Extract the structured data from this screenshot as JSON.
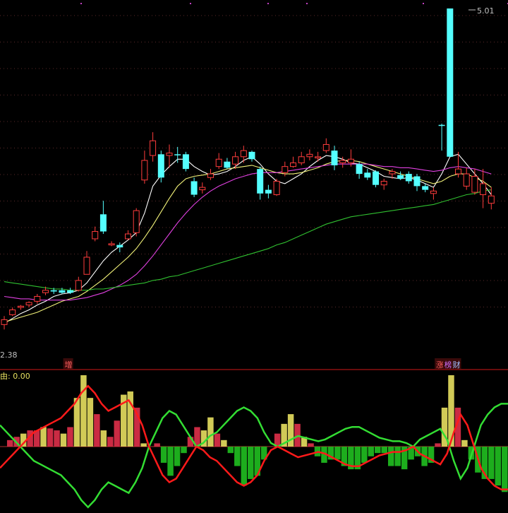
{
  "chart_data": [
    {
      "type": "candlestick",
      "panel": "price",
      "price_range": [
        2.38,
        5.01
      ],
      "high_label": "5.01",
      "low_label": "2.38",
      "markers": [
        {
          "text": "增",
          "candle": 8
        },
        {
          "text": "涨",
          "candle": 53
        },
        {
          "text": "榜",
          "candle": 54
        },
        {
          "text": "财",
          "candle": 55
        }
      ],
      "candles": [
        {
          "o": 2.43,
          "h": 2.5,
          "l": 2.39,
          "c": 2.47,
          "up": true
        },
        {
          "o": 2.51,
          "h": 2.57,
          "l": 2.5,
          "c": 2.55,
          "up": true
        },
        {
          "o": 2.57,
          "h": 2.59,
          "l": 2.55,
          "c": 2.58,
          "up": true
        },
        {
          "o": 2.59,
          "h": 2.62,
          "l": 2.57,
          "c": 2.61,
          "up": true
        },
        {
          "o": 2.62,
          "h": 2.68,
          "l": 2.6,
          "c": 2.66,
          "up": true
        },
        {
          "o": 2.69,
          "h": 2.74,
          "l": 2.67,
          "c": 2.71,
          "up": true
        },
        {
          "o": 2.7,
          "h": 2.73,
          "l": 2.68,
          "c": 2.71,
          "up": false
        },
        {
          "o": 2.71,
          "h": 2.73,
          "l": 2.68,
          "c": 2.69,
          "up": false
        },
        {
          "o": 2.69,
          "h": 2.73,
          "l": 2.68,
          "c": 2.71,
          "up": false
        },
        {
          "o": 2.71,
          "h": 2.82,
          "l": 2.7,
          "c": 2.79,
          "up": true
        },
        {
          "o": 2.84,
          "h": 3.03,
          "l": 2.84,
          "c": 2.98,
          "up": true
        },
        {
          "o": 3.13,
          "h": 3.23,
          "l": 3.11,
          "c": 3.19,
          "up": true
        },
        {
          "o": 3.33,
          "h": 3.44,
          "l": 3.17,
          "c": 3.19,
          "up": false
        },
        {
          "o": 3.08,
          "h": 3.11,
          "l": 3.07,
          "c": 3.09,
          "up": true
        },
        {
          "o": 3.08,
          "h": 3.1,
          "l": 3.02,
          "c": 3.06,
          "up": false
        },
        {
          "o": 3.13,
          "h": 3.2,
          "l": 3.12,
          "c": 3.17,
          "up": true
        },
        {
          "o": 3.18,
          "h": 3.38,
          "l": 3.15,
          "c": 3.36,
          "up": true
        },
        {
          "o": 3.61,
          "h": 3.85,
          "l": 3.58,
          "c": 3.77,
          "up": true
        },
        {
          "o": 3.81,
          "h": 4.0,
          "l": 3.76,
          "c": 3.93,
          "up": true
        },
        {
          "o": 3.82,
          "h": 3.85,
          "l": 3.59,
          "c": 3.63,
          "up": false
        },
        {
          "o": 3.81,
          "h": 3.9,
          "l": 3.71,
          "c": 3.83,
          "up": true
        },
        {
          "o": 3.82,
          "h": 3.88,
          "l": 3.75,
          "c": 3.82,
          "up": false
        },
        {
          "o": 3.82,
          "h": 3.84,
          "l": 3.68,
          "c": 3.7,
          "up": false
        },
        {
          "o": 3.6,
          "h": 3.63,
          "l": 3.47,
          "c": 3.49,
          "up": false
        },
        {
          "o": 3.53,
          "h": 3.59,
          "l": 3.5,
          "c": 3.55,
          "up": true
        },
        {
          "o": 3.63,
          "h": 3.7,
          "l": 3.61,
          "c": 3.66,
          "up": true
        },
        {
          "o": 3.72,
          "h": 3.83,
          "l": 3.7,
          "c": 3.78,
          "up": true
        },
        {
          "o": 3.76,
          "h": 3.79,
          "l": 3.7,
          "c": 3.71,
          "up": false
        },
        {
          "o": 3.74,
          "h": 3.84,
          "l": 3.7,
          "c": 3.8,
          "up": true
        },
        {
          "o": 3.8,
          "h": 3.89,
          "l": 3.75,
          "c": 3.85,
          "up": true
        },
        {
          "o": 3.84,
          "h": 3.85,
          "l": 3.76,
          "c": 3.78,
          "up": false
        },
        {
          "o": 3.7,
          "h": 3.72,
          "l": 3.45,
          "c": 3.5,
          "up": false
        },
        {
          "o": 3.53,
          "h": 3.57,
          "l": 3.46,
          "c": 3.5,
          "up": false
        },
        {
          "o": 3.49,
          "h": 3.62,
          "l": 3.48,
          "c": 3.6,
          "up": true
        },
        {
          "o": 3.67,
          "h": 3.76,
          "l": 3.64,
          "c": 3.72,
          "up": true
        },
        {
          "o": 3.72,
          "h": 3.8,
          "l": 3.71,
          "c": 3.75,
          "up": true
        },
        {
          "o": 3.75,
          "h": 3.84,
          "l": 3.73,
          "c": 3.8,
          "up": true
        },
        {
          "o": 3.8,
          "h": 3.86,
          "l": 3.77,
          "c": 3.82,
          "up": true
        },
        {
          "o": 3.79,
          "h": 3.84,
          "l": 3.76,
          "c": 3.8,
          "up": true
        },
        {
          "o": 3.85,
          "h": 3.95,
          "l": 3.83,
          "c": 3.9,
          "up": true
        },
        {
          "o": 3.85,
          "h": 3.89,
          "l": 3.69,
          "c": 3.73,
          "up": false
        },
        {
          "o": 3.75,
          "h": 3.8,
          "l": 3.71,
          "c": 3.77,
          "up": true
        },
        {
          "o": 3.78,
          "h": 3.86,
          "l": 3.72,
          "c": 3.75,
          "up": true
        },
        {
          "o": 3.74,
          "h": 3.76,
          "l": 3.62,
          "c": 3.66,
          "up": false
        },
        {
          "o": 3.67,
          "h": 3.7,
          "l": 3.61,
          "c": 3.63,
          "up": false
        },
        {
          "o": 3.68,
          "h": 3.69,
          "l": 3.55,
          "c": 3.57,
          "up": false
        },
        {
          "o": 3.57,
          "h": 3.62,
          "l": 3.53,
          "c": 3.6,
          "up": true
        },
        {
          "o": 3.66,
          "h": 3.7,
          "l": 3.62,
          "c": 3.68,
          "up": true
        },
        {
          "o": 3.65,
          "h": 3.68,
          "l": 3.61,
          "c": 3.62,
          "up": false
        },
        {
          "o": 3.66,
          "h": 3.68,
          "l": 3.58,
          "c": 3.6,
          "up": false
        },
        {
          "o": 3.64,
          "h": 3.66,
          "l": 3.52,
          "c": 3.56,
          "up": false
        },
        {
          "o": 3.56,
          "h": 3.58,
          "l": 3.51,
          "c": 3.53,
          "up": false
        },
        {
          "o": 3.5,
          "h": 3.55,
          "l": 3.45,
          "c": 3.52,
          "up": true
        },
        {
          "o": 4.06,
          "h": 4.07,
          "l": 3.85,
          "c": 4.06,
          "up": false
        },
        {
          "o": 3.8,
          "h": 5.01,
          "l": 3.8,
          "c": 5.01,
          "up": false
        },
        {
          "o": 3.66,
          "h": 3.84,
          "l": 3.63,
          "c": 3.7,
          "up": true
        },
        {
          "o": 3.66,
          "h": 3.71,
          "l": 3.53,
          "c": 3.56,
          "up": true
        },
        {
          "o": 3.51,
          "h": 3.7,
          "l": 3.49,
          "c": 3.64,
          "up": true
        },
        {
          "o": 3.58,
          "h": 3.7,
          "l": 3.38,
          "c": 3.49,
          "up": true
        },
        {
          "o": 3.48,
          "h": 3.55,
          "l": 3.37,
          "c": 3.42,
          "up": true
        }
      ],
      "ma": [
        {
          "color": "#ffffff",
          "values": [
            2.44,
            2.48,
            2.52,
            2.55,
            2.59,
            2.62,
            2.66,
            2.68,
            2.69,
            2.71,
            2.77,
            2.86,
            2.95,
            3.02,
            3.07,
            3.12,
            3.18,
            3.34,
            3.56,
            3.65,
            3.72,
            3.78,
            3.78,
            3.72,
            3.68,
            3.65,
            3.66,
            3.68,
            3.72,
            3.77,
            3.8,
            3.74,
            3.66,
            3.6,
            3.58,
            3.62,
            3.66,
            3.72,
            3.77,
            3.81,
            3.8,
            3.78,
            3.75,
            3.74,
            3.71,
            3.68,
            3.64,
            3.63,
            3.62,
            3.63,
            3.61,
            3.58,
            3.55,
            3.66,
            3.8,
            3.82,
            3.74,
            3.66,
            3.58,
            3.49
          ]
        },
        {
          "color": "#f2f279",
          "values": [
            2.45,
            2.47,
            2.49,
            2.51,
            2.53,
            2.56,
            2.59,
            2.62,
            2.64,
            2.66,
            2.7,
            2.75,
            2.8,
            2.86,
            2.92,
            2.98,
            3.05,
            3.14,
            3.24,
            3.35,
            3.46,
            3.56,
            3.62,
            3.64,
            3.65,
            3.66,
            3.68,
            3.7,
            3.71,
            3.72,
            3.73,
            3.71,
            3.69,
            3.67,
            3.66,
            3.66,
            3.67,
            3.69,
            3.71,
            3.74,
            3.76,
            3.77,
            3.77,
            3.76,
            3.74,
            3.72,
            3.7,
            3.68,
            3.66,
            3.64,
            3.62,
            3.6,
            3.58,
            3.6,
            3.64,
            3.66,
            3.66,
            3.63,
            3.6,
            3.55
          ]
        },
        {
          "color": "#e040e0",
          "values": [
            2.66,
            2.65,
            2.64,
            2.64,
            2.63,
            2.63,
            2.63,
            2.63,
            2.63,
            2.64,
            2.65,
            2.67,
            2.69,
            2.72,
            2.75,
            2.79,
            2.84,
            2.91,
            2.99,
            3.08,
            3.17,
            3.26,
            3.34,
            3.41,
            3.47,
            3.52,
            3.56,
            3.59,
            3.62,
            3.64,
            3.66,
            3.67,
            3.67,
            3.67,
            3.68,
            3.69,
            3.7,
            3.71,
            3.72,
            3.73,
            3.74,
            3.74,
            3.74,
            3.74,
            3.74,
            3.73,
            3.72,
            3.72,
            3.71,
            3.71,
            3.7,
            3.69,
            3.68,
            3.69,
            3.71,
            3.72,
            3.71,
            3.7,
            3.68,
            3.66
          ]
        },
        {
          "color": "#30c030",
          "values": [
            2.78,
            2.77,
            2.76,
            2.75,
            2.74,
            2.73,
            2.72,
            2.72,
            2.71,
            2.71,
            2.71,
            2.72,
            2.72,
            2.73,
            2.74,
            2.75,
            2.76,
            2.77,
            2.79,
            2.8,
            2.82,
            2.83,
            2.85,
            2.87,
            2.89,
            2.91,
            2.93,
            2.95,
            2.97,
            2.99,
            3.01,
            3.03,
            3.05,
            3.08,
            3.1,
            3.13,
            3.16,
            3.19,
            3.22,
            3.25,
            3.27,
            3.29,
            3.31,
            3.32,
            3.33,
            3.34,
            3.35,
            3.36,
            3.37,
            3.38,
            3.39,
            3.4,
            3.41,
            3.43,
            3.45,
            3.47,
            3.49,
            3.5,
            3.52,
            3.53
          ]
        }
      ]
    },
    {
      "type": "bar",
      "panel": "indicator",
      "title_char": "由",
      "title_value": "0.00",
      "range": [
        -100,
        100
      ],
      "bars": [
        0,
        10,
        15,
        20,
        25,
        25,
        30,
        28,
        25,
        20,
        30,
        75,
        110,
        75,
        50,
        25,
        15,
        40,
        80,
        85,
        60,
        5,
        0,
        5,
        -25,
        -45,
        -30,
        -10,
        15,
        30,
        25,
        45,
        20,
        10,
        -10,
        -30,
        -60,
        -50,
        -45,
        -20,
        0,
        20,
        35,
        50,
        35,
        15,
        5,
        -15,
        -25,
        -20,
        -20,
        -30,
        -35,
        -35,
        -25,
        -15,
        -10,
        -10,
        -30,
        -30,
        -35,
        -20,
        -15,
        -30,
        -25,
        5,
        60,
        110,
        60,
        10,
        -20,
        -40,
        -50,
        -50,
        -60,
        -70
      ],
      "red_line": [
        -60,
        -40,
        -20,
        0,
        20,
        40,
        50,
        60,
        70,
        80,
        100,
        120,
        150,
        170,
        150,
        120,
        100,
        110,
        120,
        130,
        100,
        60,
        0,
        -40,
        -80,
        -100,
        -90,
        -60,
        -30,
        0,
        -10,
        -30,
        -40,
        -60,
        -80,
        -100,
        -110,
        -100,
        -80,
        -40,
        -10,
        0,
        -10,
        -20,
        -30,
        -25,
        -20,
        -15,
        -20,
        -30,
        -40,
        -50,
        -55,
        -55,
        -45,
        -35,
        -25,
        -20,
        -15,
        -15,
        -10,
        0,
        -20,
        -30,
        -40,
        -50,
        -20,
        40,
        90,
        60,
        0,
        -60,
        -90,
        -110,
        -120,
        -120
      ],
      "green_line": [
        60,
        40,
        20,
        0,
        -20,
        -40,
        -50,
        -60,
        -70,
        -80,
        -100,
        -120,
        -150,
        -170,
        -150,
        -120,
        -100,
        -110,
        -120,
        -130,
        -100,
        -60,
        0,
        40,
        80,
        100,
        90,
        60,
        30,
        0,
        10,
        30,
        40,
        60,
        80,
        100,
        110,
        100,
        80,
        40,
        10,
        0,
        10,
        20,
        30,
        25,
        20,
        15,
        20,
        30,
        40,
        50,
        55,
        55,
        45,
        35,
        25,
        20,
        15,
        15,
        10,
        0,
        20,
        30,
        40,
        50,
        20,
        -40,
        -90,
        -60,
        0,
        60,
        90,
        110,
        120,
        120
      ]
    }
  ],
  "colors": {
    "up": "#ff3c3c",
    "down": "#54ffff",
    "bar_red": "#e0304a",
    "bar_yellow": "#e8e060",
    "bar_green": "#20c020",
    "line_red": "#ff1a1a",
    "line_green": "#33dd33",
    "divider": "#8a1010",
    "grid_dot": "#5a2a2a",
    "axis": "#b03030",
    "label_gray": "#c0c0c0",
    "label_yellow": "#e8e060",
    "marker_bg": "#3a0a0a"
  }
}
